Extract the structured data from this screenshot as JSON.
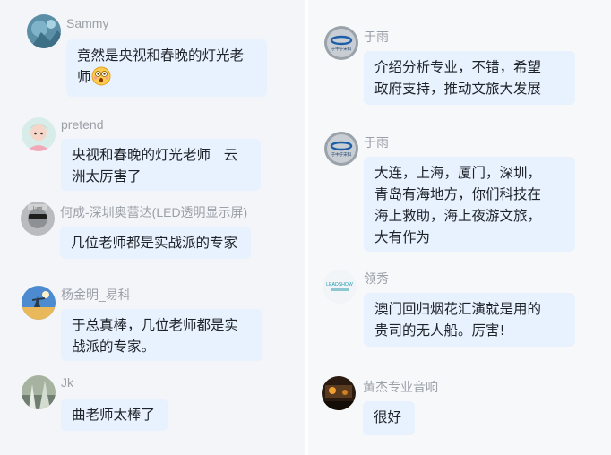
{
  "left_messages": [
    {
      "name": "Sammy",
      "text": "竟然是央视和春晚的灯光老\n师",
      "emoji": "astonished-face-icon"
    },
    {
      "name": "pretend",
      "text": "央视和春晚的灯光老师   云\n洲太厉害了"
    },
    {
      "name": "何成-深圳奥蕾达(LED透明显示屏)",
      "text": "几位老师都是实战派的专家"
    },
    {
      "name": "杨金明_易科",
      "text": "于总真棒，几位老师都是实\n战派的专家。"
    },
    {
      "name": "Jk",
      "text": "曲老师太棒了"
    }
  ],
  "right_messages": [
    {
      "name": "于雨",
      "text": "介绍分析专业，不错，希望\n政府支持，推动文旅大发展"
    },
    {
      "name": "于雨",
      "text": "大连，上海，厦门，深圳，\n青岛有海地方，你们科技在\n海上救助，海上夜游文旅，\n大有作为"
    },
    {
      "name": "领秀",
      "text": "澳门回归烟花汇演就是用的\n贵司的无人船。厉害!",
      "avatar_text": "LEADSHOW"
    },
    {
      "name": "黄杰专业音响",
      "text": "很好"
    }
  ],
  "colors": {
    "bubble": "#e8f1fe",
    "name": "#9aa0a8",
    "text": "#1e2329"
  }
}
